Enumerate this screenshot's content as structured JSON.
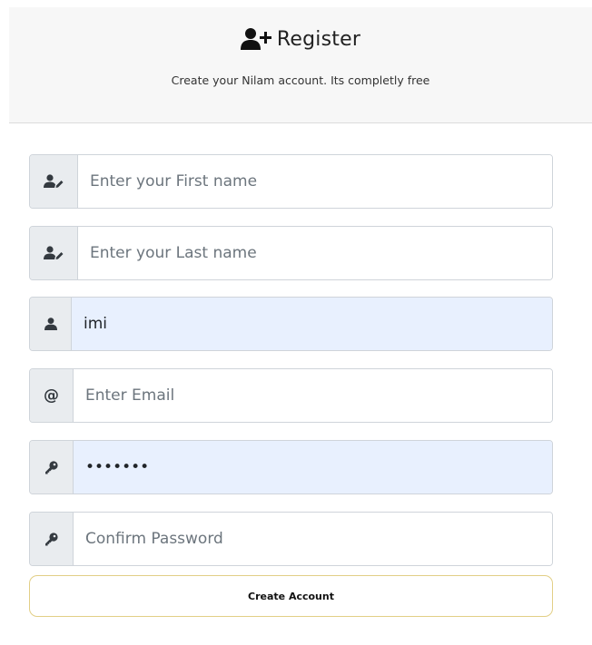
{
  "header": {
    "icon": "user-plus-icon",
    "title": "Register",
    "subtitle": "Create your Nilam account. Its completly free"
  },
  "form": {
    "first_name": {
      "icon": "user-pen-icon",
      "value": "",
      "placeholder": "Enter your First name"
    },
    "last_name": {
      "icon": "user-pen-icon",
      "value": "",
      "placeholder": "Enter your Last name"
    },
    "username": {
      "icon": "user-icon",
      "value": "imi",
      "placeholder": ""
    },
    "email": {
      "icon": "at-icon",
      "glyph": "@",
      "value": "",
      "placeholder": "Enter Email"
    },
    "password": {
      "icon": "key-icon",
      "value": "imiimii",
      "placeholder": ""
    },
    "confirm_password": {
      "icon": "key-icon",
      "value": "",
      "placeholder": "Confirm Password"
    },
    "submit_label": "Create Account"
  },
  "colors": {
    "header_bg": "#f7f7f7",
    "addon_bg": "#e9ecef",
    "field_border": "#cfd4da",
    "autofill_bg": "#e8f0fe",
    "button_border": "#e2cf86"
  }
}
